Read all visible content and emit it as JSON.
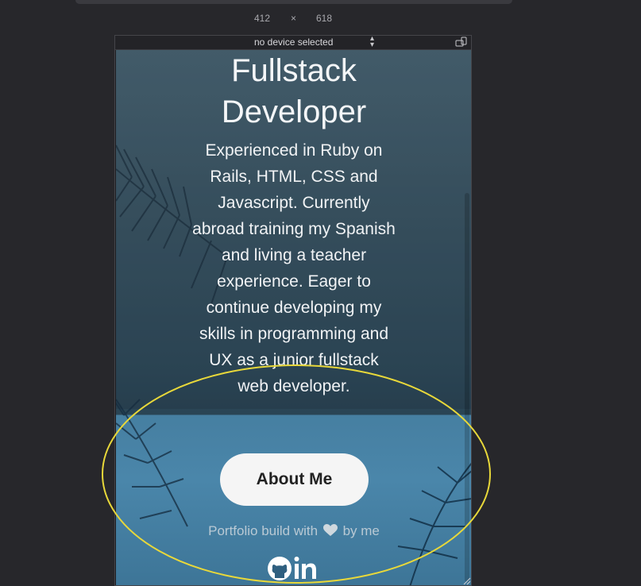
{
  "devtools": {
    "width_value": "412",
    "times_sign": "×",
    "height_value": "618",
    "device_select": "no device selected"
  },
  "hero": {
    "title_line1": "Fullstack",
    "title_line2": "Developer",
    "description": "Experienced in Ruby on Rails, HTML, CSS and Javascript. Currently abroad training my Spanish and living a teacher experience. Eager to continue developing my skills in programming and UX as a junior fullstack web developer."
  },
  "cta": {
    "about_label": "About Me"
  },
  "footer": {
    "text_before": "Portfolio build with",
    "text_after": "by me",
    "icons": [
      "github-icon",
      "linkedin-icon"
    ]
  },
  "colors": {
    "page_bg": "#27272b",
    "annotation": "#e8d83a",
    "button_bg": "#f5f5f5"
  }
}
